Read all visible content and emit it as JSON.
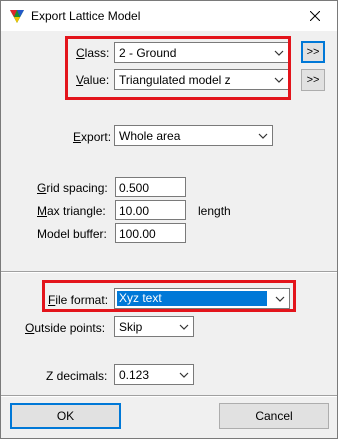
{
  "window": {
    "title": "Export Lattice Model",
    "close_glyph": "✕"
  },
  "fields": {
    "class": {
      "label": "Class:",
      "mnemonic": "C",
      "value": "2 - Ground",
      "more_button": ">>"
    },
    "value": {
      "label": "Value:",
      "mnemonic": "V",
      "value": "Triangulated model z",
      "more_button": ">>"
    },
    "export": {
      "label": "Export:",
      "mnemonic": "E",
      "value": "Whole area"
    },
    "grid_spacing": {
      "label": "Grid spacing:",
      "mnemonic": "G",
      "value": "0.500"
    },
    "max_triangle": {
      "label": "Max triangle:",
      "mnemonic": "M",
      "value": "10.00",
      "unit": "length"
    },
    "model_buffer": {
      "label": "Model buffer:",
      "value": "100.00"
    },
    "file_format": {
      "label": "File format:",
      "mnemonic": "F",
      "value": "Xyz text"
    },
    "outside_points": {
      "label": "Outside points:",
      "mnemonic": "O",
      "value": "Skip"
    },
    "z_decimals": {
      "label": "Z decimals:",
      "value": "0.123"
    }
  },
  "buttons": {
    "ok": "OK",
    "cancel": "Cancel"
  },
  "colors": {
    "highlight_box": "#e3141b",
    "selection": "#0078d7",
    "focus": "#0078d7"
  }
}
